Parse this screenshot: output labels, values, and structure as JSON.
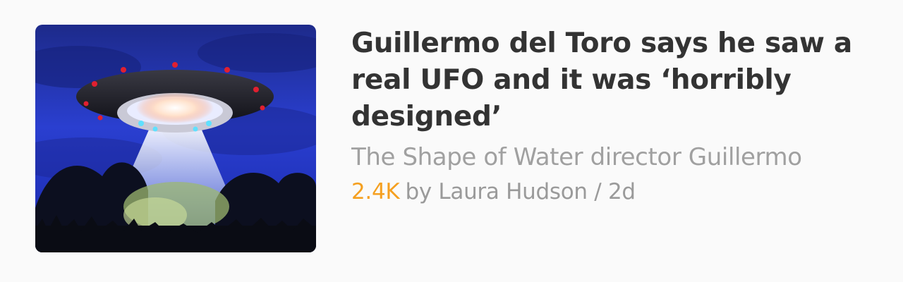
{
  "article": {
    "image_alt": "ufo-illustration",
    "headline": "Guillermo del Toro says he saw a real UFO and it was ‘horribly designed’",
    "subtitle": "The Shape of Water director Guillermo",
    "count": "2.4K",
    "byline": "by Laura Hudson / 2d"
  },
  "colors": {
    "background": "#fafafa",
    "headline": "#333333",
    "subtitle": "#a0a0a0",
    "count_accent": "#f5a020"
  }
}
